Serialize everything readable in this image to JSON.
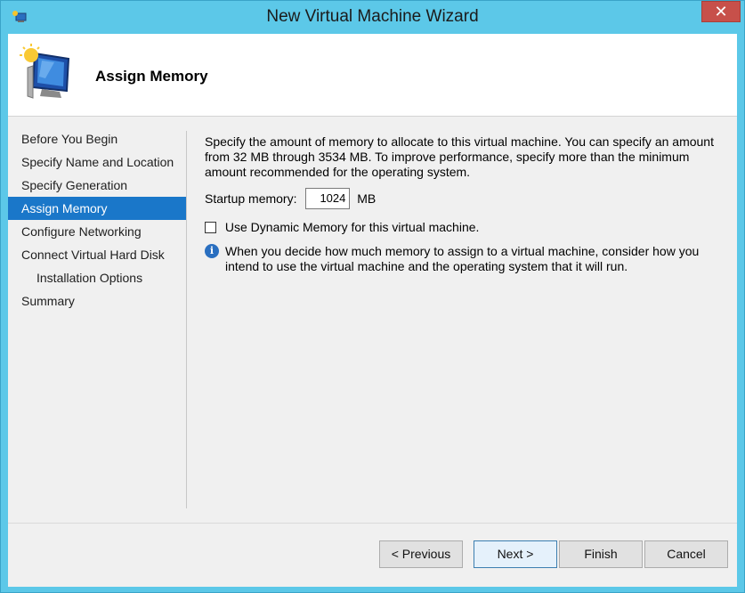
{
  "window": {
    "title": "New Virtual Machine Wizard",
    "close_label": "✕"
  },
  "header": {
    "title": "Assign Memory"
  },
  "nav": {
    "items": [
      {
        "label": "Before You Begin"
      },
      {
        "label": "Specify Name and Location"
      },
      {
        "label": "Specify Generation"
      },
      {
        "label": "Assign Memory"
      },
      {
        "label": "Configure Networking"
      },
      {
        "label": "Connect Virtual Hard Disk"
      },
      {
        "label": "Installation Options"
      },
      {
        "label": "Summary"
      }
    ],
    "active_index": 3
  },
  "content": {
    "description": "Specify the amount of memory to allocate to this virtual machine. You can specify an amount from 32 MB through 3534 MB. To improve performance, specify more than the minimum amount recommended for the operating system.",
    "startup_memory_label": "Startup memory:",
    "startup_memory_value": "1024",
    "startup_memory_unit": "MB",
    "dynamic_memory_label": "Use Dynamic Memory for this virtual machine.",
    "dynamic_memory_checked": false,
    "info_icon": "info-icon",
    "info_text": "When you decide how much memory to assign to a virtual machine, consider how you intend to use the virtual machine and the operating system that it will run."
  },
  "buttons": {
    "previous": "< Previous",
    "next": "Next >",
    "finish": "Finish",
    "cancel": "Cancel"
  },
  "colors": {
    "title_bar": "#5cc8e8",
    "selected_nav": "#1a77c9",
    "close_button": "#c7504a"
  }
}
